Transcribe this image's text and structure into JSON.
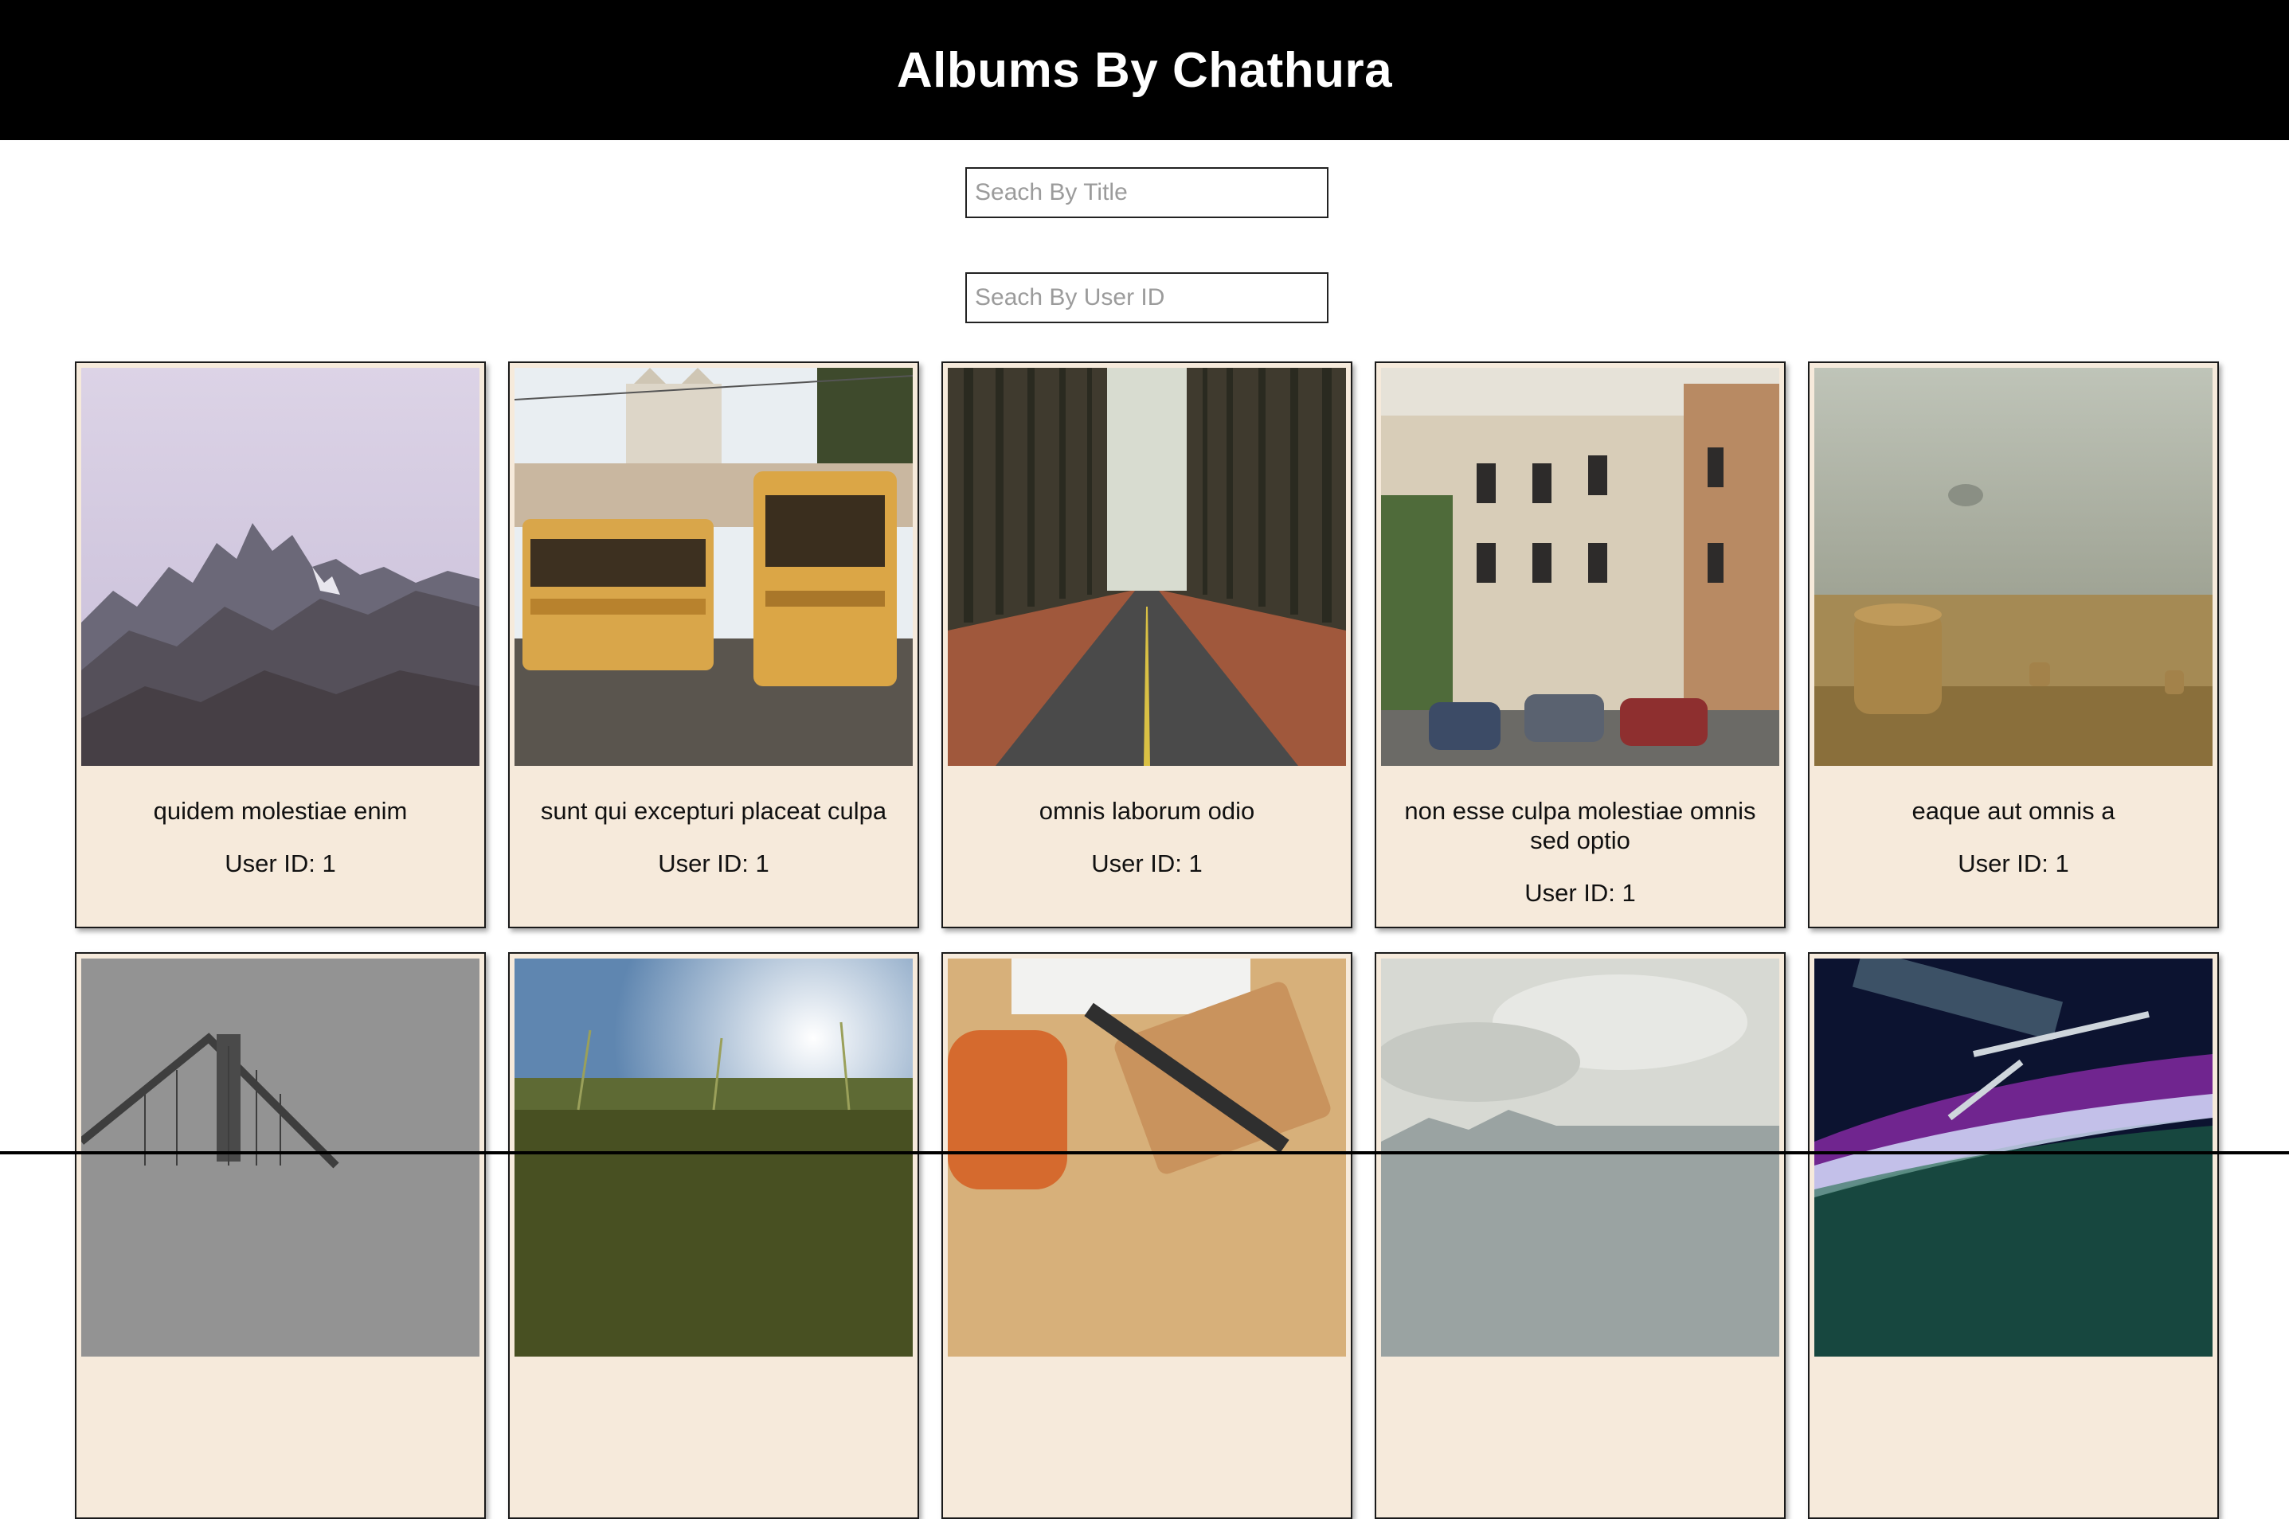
{
  "header": {
    "title": "Albums By Chathura"
  },
  "search": {
    "title_placeholder": "Seach By Title",
    "user_placeholder": "Seach By User ID"
  },
  "albums": [
    {
      "title": "quidem molestiae enim",
      "user": "User ID: 1",
      "image": "mountain-peaks"
    },
    {
      "title": "sunt qui excepturi placeat culpa",
      "user": "User ID: 1",
      "image": "yellow-trams"
    },
    {
      "title": "omnis laborum odio",
      "user": "User ID: 1",
      "image": "forest-road"
    },
    {
      "title": "non esse culpa molestiae omnis sed optio",
      "user": "User ID: 1",
      "image": "old-street-buildings"
    },
    {
      "title": "eaque aut omnis a",
      "user": "User ID: 1",
      "image": "hay-bales-fog"
    },
    {
      "image": "bridge-over-water"
    },
    {
      "image": "grass-sunlight"
    },
    {
      "image": "desk-notebook"
    },
    {
      "image": "cloudy-mountains"
    },
    {
      "image": "space-station-aurora"
    }
  ],
  "colors": {
    "header_bg": "#000000",
    "card_bg": "#f6eadb",
    "card_border": "#1a1a1a"
  }
}
